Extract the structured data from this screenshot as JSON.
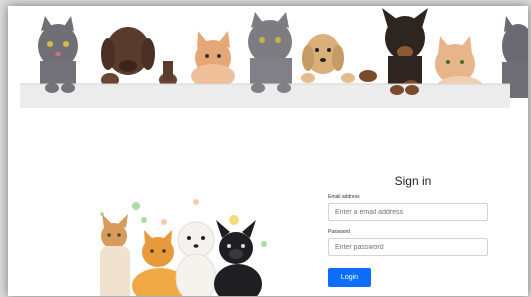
{
  "banner": {
    "image_name": "pets-peeking-over-wall-banner"
  },
  "illustration": {
    "image_name": "cats-and-dogs-group-illustration"
  },
  "login": {
    "title": "Sign in",
    "email_label": "Email address",
    "email_placeholder": "Enter a email address",
    "email_value": "",
    "password_label": "Password",
    "password_placeholder": "Enter password",
    "password_value": "",
    "login_button_label": "Login"
  },
  "colors": {
    "primary_button": "#0d6efd",
    "page_background": "#ffffff"
  }
}
